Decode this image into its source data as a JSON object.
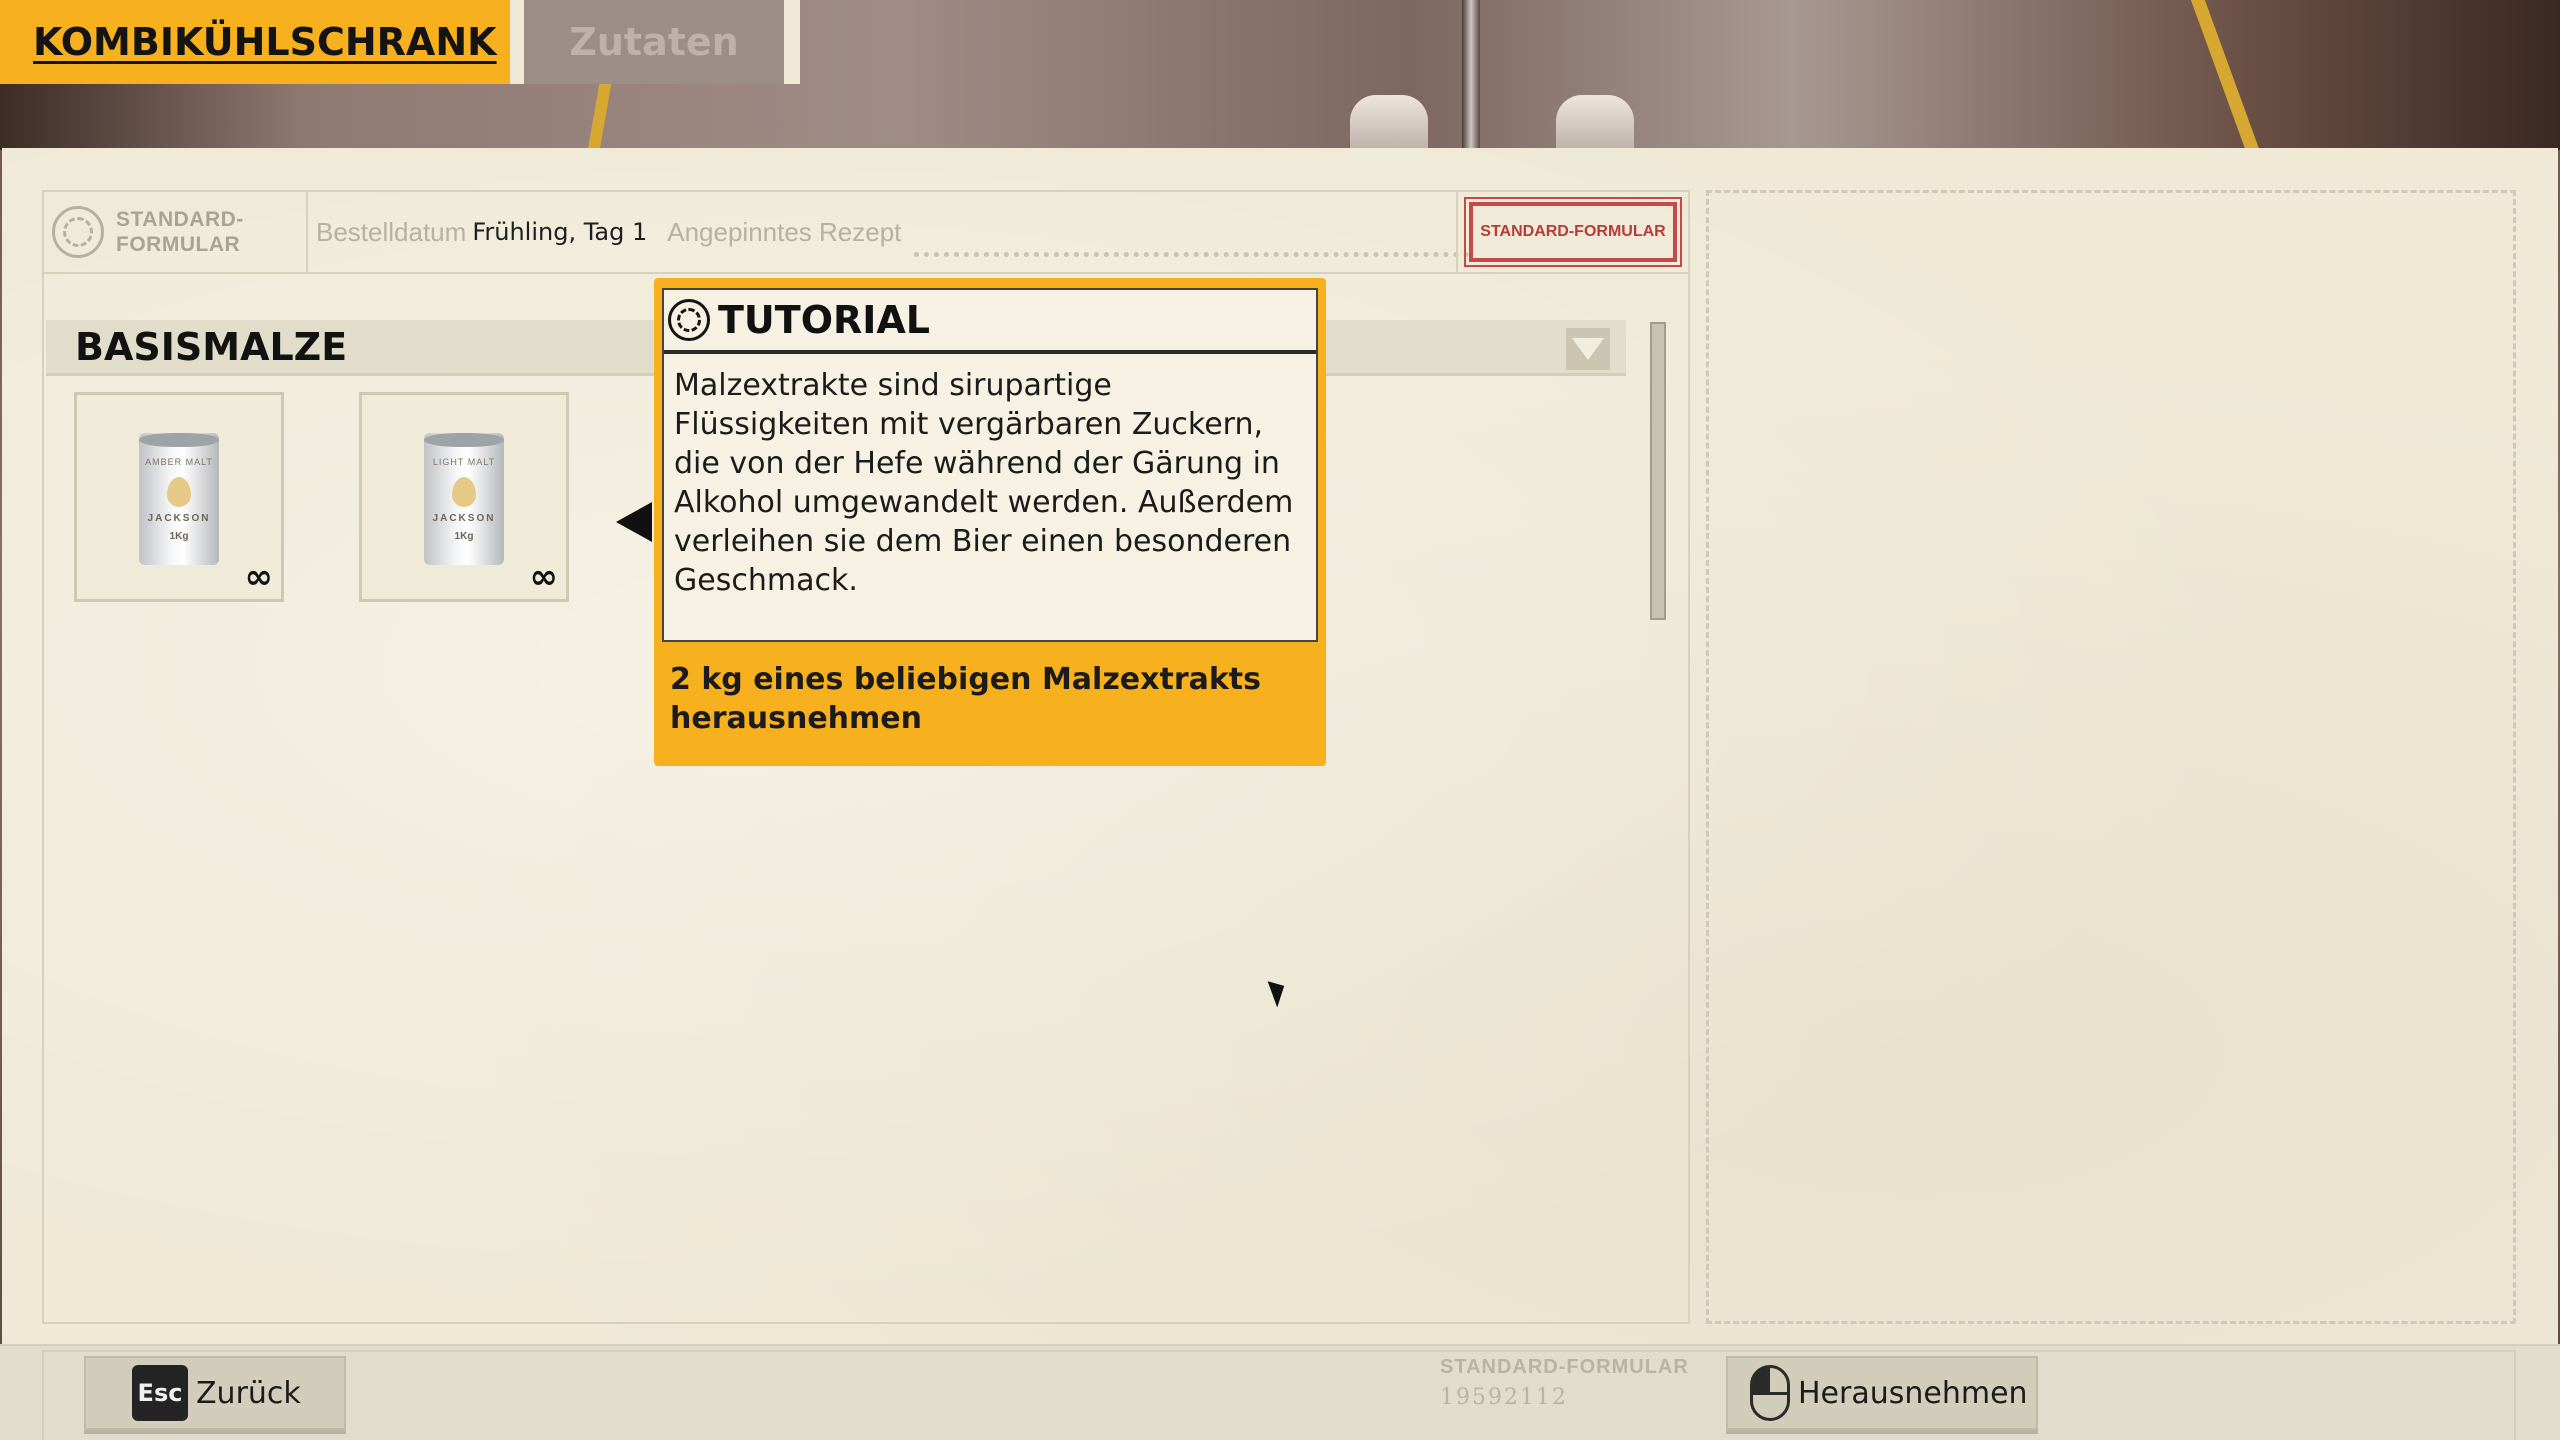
{
  "tabs": [
    {
      "label": "KOMBIKÜHLSCHRANK",
      "active": true
    },
    {
      "label": "Zutaten",
      "active": false
    }
  ],
  "form": {
    "logo_text": "STANDARD-\nFORMULAR",
    "logo_line1": "STANDARD-",
    "logo_line2": "FORMULAR",
    "order_date_label": "Bestelldatum",
    "order_date_value": "Frühling, Tag 1",
    "pinned_recipe_label": "Angepinntes Rezept",
    "stamp": "STANDARD-FORMULAR"
  },
  "category": {
    "title": "BASISMALZE",
    "dropdown_icon": "chevron-down-icon"
  },
  "items": [
    {
      "name": "AMBER MALT",
      "brand": "JACKSON",
      "weight": "1Kg",
      "quantity": "∞"
    },
    {
      "name": "LIGHT MALT",
      "brand": "JACKSON",
      "weight": "1Kg",
      "quantity": "∞"
    }
  ],
  "tutorial": {
    "title": "TUTORIAL",
    "body": "Malzextrakte sind sirupartige Flüssigkeiten mit vergärbaren Zuckern, die von der Hefe während der Gärung in Alkohol umgewandelt werden. Außerdem verleihen sie dem Bier einen besonderen Geschmack.",
    "task": "2 kg eines beliebigen Malzextrakts herausnehmen"
  },
  "footer": {
    "back_key": "Esc",
    "back_label": "Zurück",
    "form_type": "STANDARD-FORMULAR",
    "form_number": "19592112",
    "take_label": "Herausnehmen"
  },
  "colors": {
    "accent": "#f7b01e",
    "paper": "#efe9d6",
    "stamp_red": "#c24a4a"
  }
}
